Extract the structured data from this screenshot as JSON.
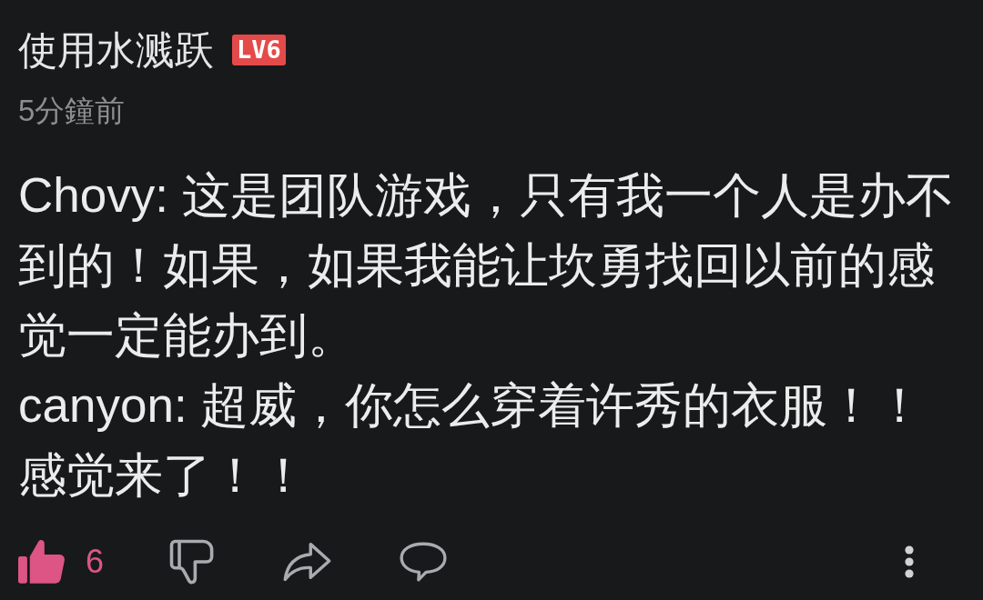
{
  "comment": {
    "author": "使用水溅跃",
    "level_badge": "LV6",
    "time": "5分鐘前",
    "lines": [
      "Chovy: 这是团队游戏，只有我一个人是办不到的！如果，如果我能让坎勇找回以前的感觉一定能办到。",
      "canyon: 超威，你怎么穿着许秀的衣服！！感觉来了！！"
    ]
  },
  "actions": {
    "liked": true,
    "like_count": "6"
  }
}
